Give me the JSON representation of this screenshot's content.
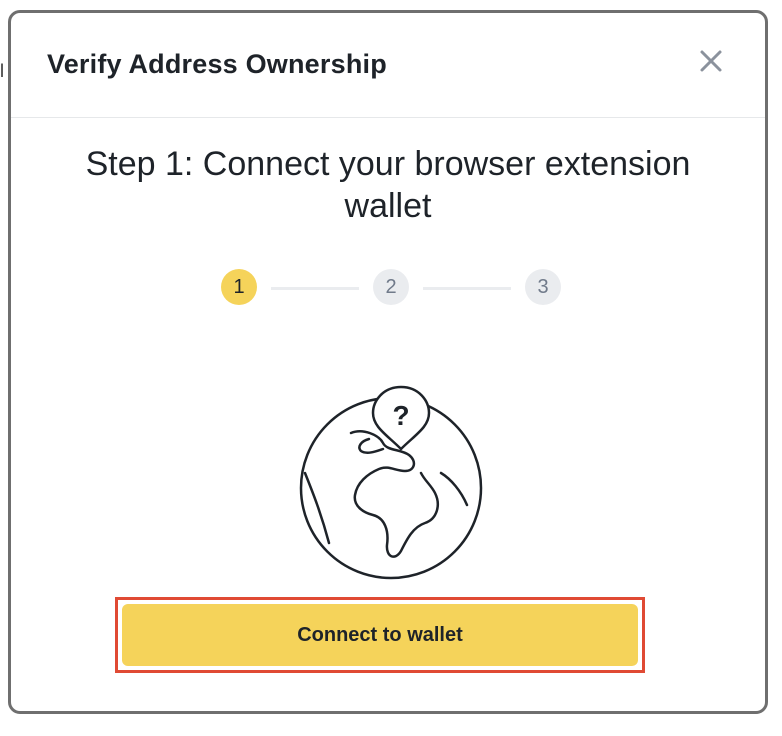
{
  "backdrop": {
    "edge_text": "l"
  },
  "modal": {
    "title": "Verify Address Ownership",
    "close_icon": "close-icon"
  },
  "step": {
    "heading": "Step 1: Connect your browser extension wallet",
    "current": 1,
    "steps": [
      {
        "label": "1",
        "state": "active"
      },
      {
        "label": "2",
        "state": "inactive"
      },
      {
        "label": "3",
        "state": "inactive"
      }
    ]
  },
  "illustration": {
    "icon": "globe-question-icon"
  },
  "actions": {
    "connect_label": "Connect to wallet"
  },
  "colors": {
    "accent": "#f5d35a",
    "text": "#1e2329",
    "muted": "#707a8a",
    "inactive_bg": "#eaecef",
    "highlight_border": "#e04a34"
  }
}
